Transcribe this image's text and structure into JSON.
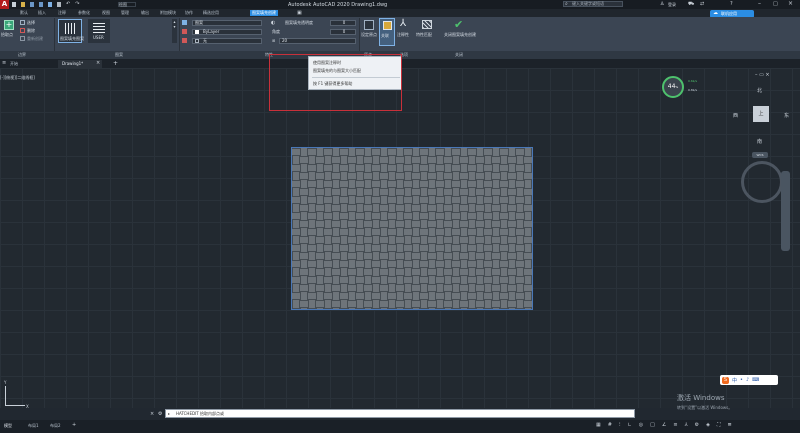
{
  "app": {
    "logo": "A",
    "title": "Autodesk AutoCAD 2020  Drawing1.dwg",
    "search_placeholder": "键入关键字或短语",
    "user": "登录"
  },
  "qat": {
    "workspace": "绘图"
  },
  "menu_tabs": [
    "默认",
    "插入",
    "注释",
    "参数化",
    "视图",
    "管理",
    "输出",
    "附加模块",
    "协作",
    "精选应用",
    "图案填充创建"
  ],
  "active_menu_tab": "图案填充创建",
  "cloud_badge": "联机应用",
  "ribbon": {
    "boundary": {
      "pick_label": "拾取点",
      "select_label": "选择",
      "remove_label": "删除",
      "recreate_label": "重新创建"
    },
    "pattern": {
      "name": "图案填充图案",
      "thumb2": "USER"
    },
    "properties": {
      "type": "图案",
      "color": "ByLayer",
      "bg": "无",
      "transparency_label": "图案填充透明度",
      "transparency_value": "0",
      "angle_label": "角度",
      "angle_value": "0",
      "scale_label": "比例",
      "scale_value": "20"
    },
    "origin_label": "设定原点",
    "assoc_label": "关联",
    "annot_label": "注释性",
    "match_label": "特性匹配",
    "close_label": "关闭图案填充创建",
    "panel_titles": [
      "边界",
      "图案",
      "特性",
      "原点",
      "选项",
      "关闭"
    ]
  },
  "tooltip": {
    "line1": "使用图案注释时",
    "line2": "图案填充的与图案大小匹配",
    "footer": "按 F1 键获得更多帮助"
  },
  "doc_tabs": [
    "开始",
    "Drawing1*"
  ],
  "viewport_label": "[-][俯视][二维线框]",
  "compass": {
    "n": "北",
    "s": "南",
    "w": "西",
    "e": "东",
    "cube": "上",
    "wcs": "WCS"
  },
  "clock": {
    "value": "44",
    "unit": "%",
    "up": "0.6k/s",
    "down": "0.8k/s"
  },
  "command_line": "HATCHEDIT 拾取内部点或",
  "layout_tabs": [
    "模型",
    "布局1",
    "布局2"
  ],
  "watermark": {
    "title": "激活 Windows",
    "sub": "转到“设置”以激活 Windows。"
  },
  "ime": "中"
}
